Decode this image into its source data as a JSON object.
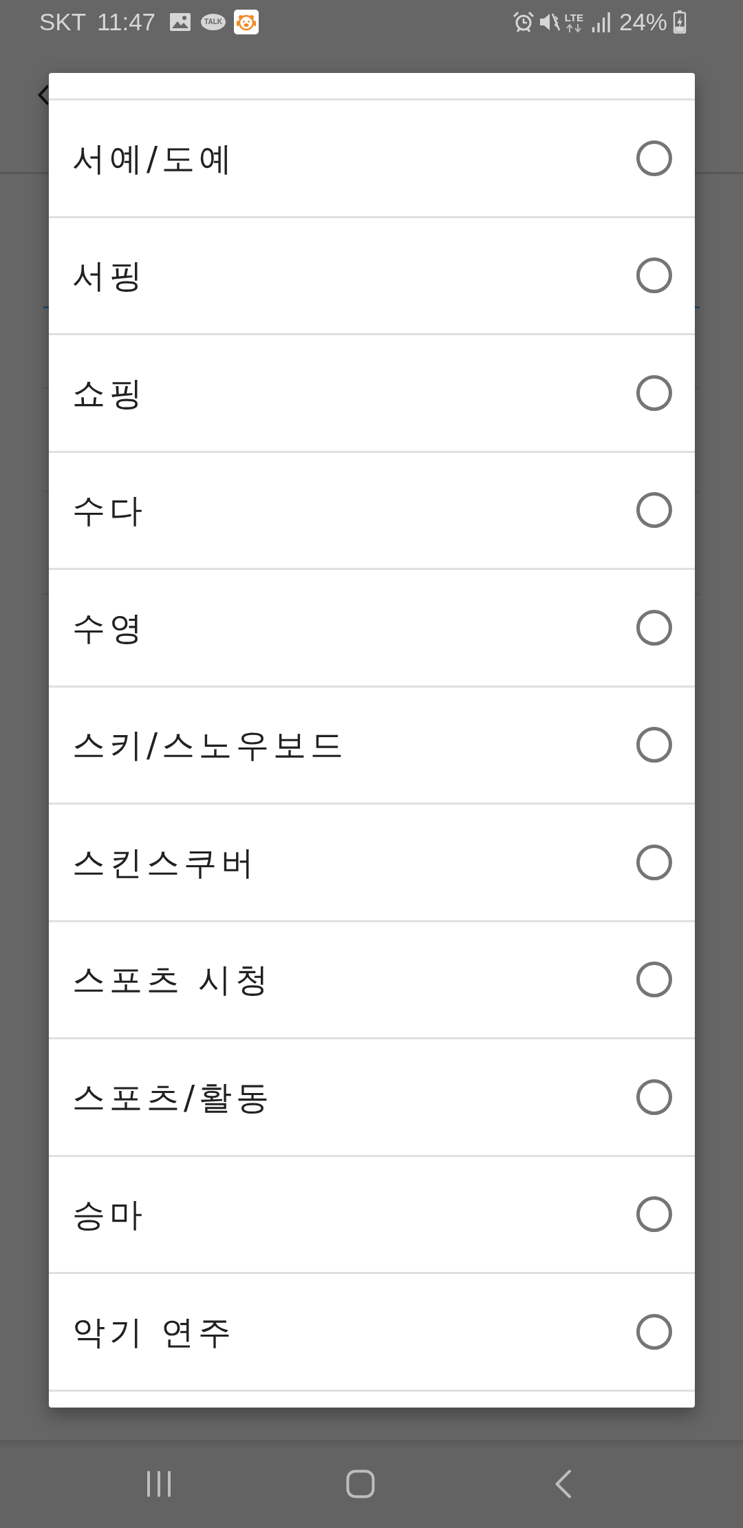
{
  "status_bar": {
    "carrier": "SKT",
    "time": "11:47",
    "talk_badge": "TALK",
    "network": "LTE",
    "battery": "24%"
  },
  "dialog": {
    "options": [
      {
        "label": "서예/도예",
        "selected": false
      },
      {
        "label": "서핑",
        "selected": false
      },
      {
        "label": "쇼핑",
        "selected": false
      },
      {
        "label": "수다",
        "selected": false
      },
      {
        "label": "수영",
        "selected": false
      },
      {
        "label": "스키/스노우보드",
        "selected": false
      },
      {
        "label": "스킨스쿠버",
        "selected": false
      },
      {
        "label": "스포츠 시청",
        "selected": false
      },
      {
        "label": "스포츠/활동",
        "selected": false
      },
      {
        "label": "승마",
        "selected": false
      },
      {
        "label": "악기 연주",
        "selected": false
      }
    ]
  }
}
